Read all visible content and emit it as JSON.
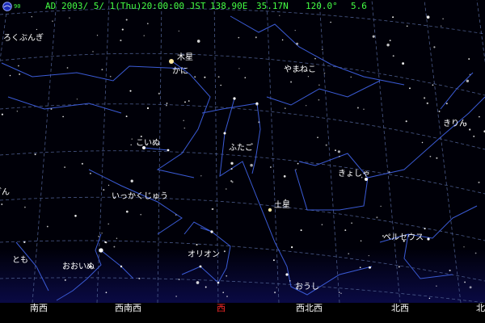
{
  "colors": {
    "sky_top": "#000008",
    "sky_bottom": "#0a0a44",
    "grid": "#4a5a8a",
    "constellation_line": "#3b5bd6",
    "status_text": "#44ff44",
    "label_text": "#ffffff",
    "direction_text": "#ffffff",
    "west_highlight": "#ff2a2a",
    "horizon_band": "#0c0c55"
  },
  "status_bar": {
    "logo_icon": "observatory-logo-icon",
    "logo_sub": "90",
    "era": "AD",
    "date": "2003/ 5/ 1(Thu)",
    "time": "20:00:00 JST",
    "longitude": "138.90E",
    "latitude": "35.17N",
    "azimuth": "120.0°",
    "magnitude_limit": "5.6"
  },
  "planets": [
    {
      "name": "木星"
    },
    {
      "name": "土星"
    }
  ],
  "constellations": [
    {
      "name": "ろくぶんぎ"
    },
    {
      "name": "かに"
    },
    {
      "name": "やまねこ"
    },
    {
      "name": "きりん"
    },
    {
      "name": "こいぬ"
    },
    {
      "name": "ふたご"
    },
    {
      "name": "きょしゃ"
    },
    {
      "name": "いっかくじゅう"
    },
    {
      "name": "ぎん"
    },
    {
      "name": "ペルセウス"
    },
    {
      "name": "とも"
    },
    {
      "name": "おおいぬ"
    },
    {
      "name": "オリオン"
    },
    {
      "name": "おうし"
    }
  ],
  "horizon_directions": [
    {
      "label": "南西",
      "highlight": false
    },
    {
      "label": "西南西",
      "highlight": false
    },
    {
      "label": "西",
      "highlight": true
    },
    {
      "label": "西北西",
      "highlight": false
    },
    {
      "label": "北西",
      "highlight": false
    },
    {
      "label": "北",
      "highlight": false
    }
  ]
}
